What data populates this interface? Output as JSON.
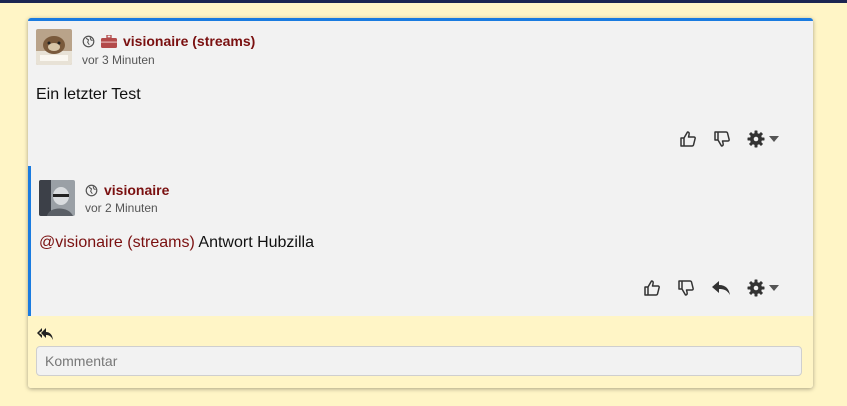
{
  "post": {
    "author": "visionaire (streams)",
    "time": "vor 3 Minuten",
    "body": "Ein letzter Test"
  },
  "reply": {
    "author": "visionaire",
    "time": "vor 2 Minuten",
    "mention": "@visionaire (streams)",
    "body": " Antwort Hubzilla"
  },
  "comment": {
    "placeholder": "Kommentar"
  },
  "colors": {
    "accent": "#1a7be0",
    "author": "#7a1010",
    "background": "#fff5c6",
    "card": "#f2f2f2"
  },
  "icons": {
    "globe": "globe-icon",
    "briefcase": "briefcase-icon",
    "like": "thumbs-up-icon",
    "dislike": "thumbs-down-icon",
    "reply": "reply-icon",
    "settings": "gear-icon",
    "caret": "caret-down-icon",
    "reply_all": "reply-all-icon"
  }
}
